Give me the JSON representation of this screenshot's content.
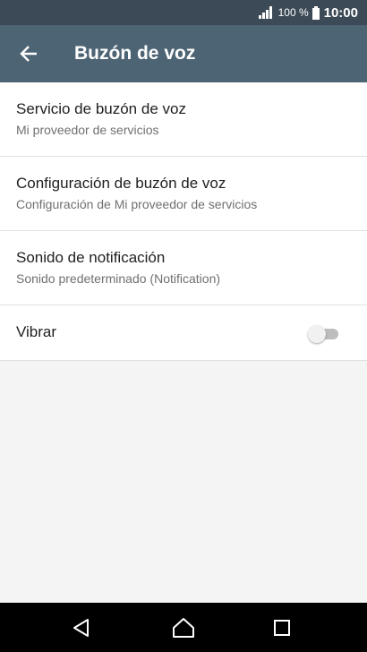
{
  "status_bar": {
    "battery_percent": "100 %",
    "time": "10:00"
  },
  "app_bar": {
    "title": "Buzón de voz"
  },
  "settings": {
    "items": [
      {
        "title": "Servicio de buzón de voz",
        "subtitle": "Mi proveedor de servicios"
      },
      {
        "title": "Configuración de buzón de voz",
        "subtitle": "Configuración de Mi proveedor de servicios"
      },
      {
        "title": "Sonido de notificación",
        "subtitle": "Sonido predeterminado (Notification)"
      },
      {
        "title": "Vibrar",
        "toggle_on": false
      }
    ]
  },
  "icons": {
    "back": "arrow-left-icon",
    "signal": "cell-signal-icon",
    "battery": "battery-icon",
    "nav_back": "triangle-back-icon",
    "nav_home": "home-icon",
    "nav_recent": "square-recent-icon"
  },
  "colors": {
    "status_bar": "#3b4a56",
    "app_bar": "#4d6475",
    "background": "#f4f4f4"
  }
}
